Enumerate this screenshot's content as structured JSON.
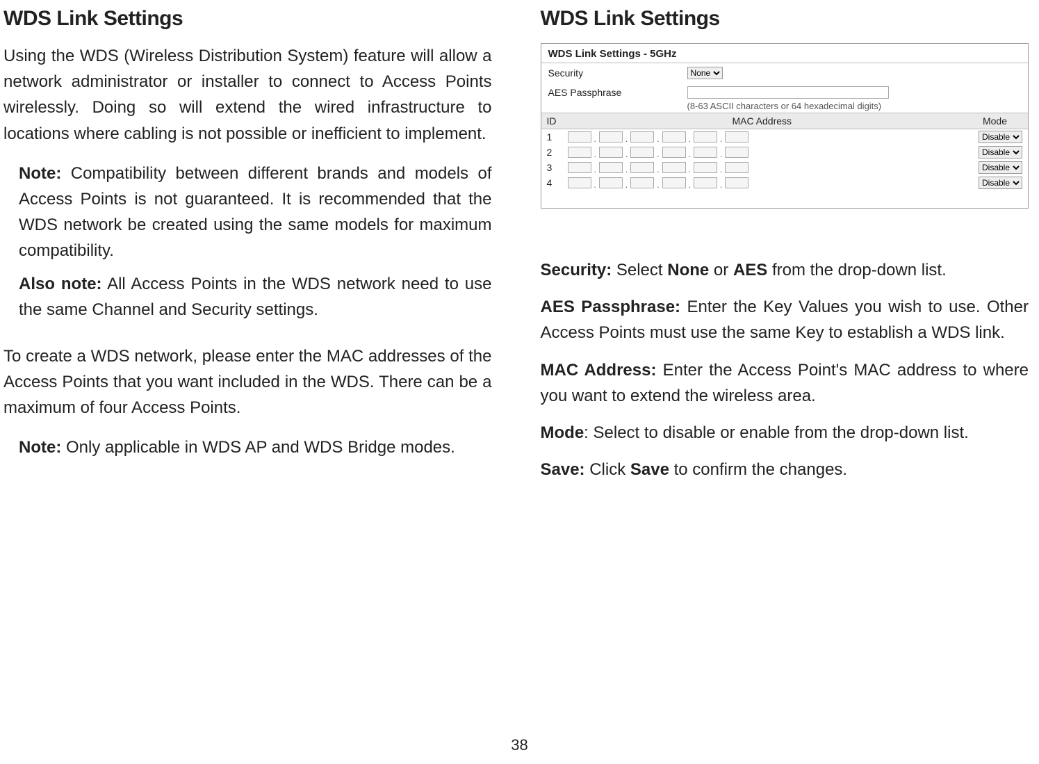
{
  "left": {
    "heading": "WDS Link Settings",
    "intro": "Using the WDS (Wireless Distribution System) feature will allow a network administrator or installer to connect to Access Points wirelessly. Doing so will extend the wired infrastructure to locations where cabling is not possible or inefficient to implement.",
    "note1_label": "Note:",
    "note1_text": " Compatibility between different brands and models of Access Points is not guaranteed. It is recommended that the WDS network be created using the same models for maximum compatibility.",
    "note2_label": "Also note:",
    "note2_text": " All Access Points in the WDS network need to use the same Channel and Security settings.",
    "para2": "To create a WDS network, please enter the MAC addresses of the Access Points that you want included in the WDS. There can be a maximum of four Access Points.",
    "note3_label": "Note:",
    "note3_text": " Only applicable in WDS AP and WDS Bridge modes."
  },
  "right": {
    "heading": "WDS Link Settings",
    "panel": {
      "title": "WDS Link Settings - 5GHz",
      "security_label": "Security",
      "security_value": "None",
      "passphrase_label": "AES Passphrase",
      "passphrase_hint": "(8-63 ASCII characters or 64 hexadecimal digits)",
      "table": {
        "headers": {
          "id": "ID",
          "mac": "MAC Address",
          "mode": "Mode"
        },
        "rows": [
          {
            "id": "1",
            "mode": "Disable"
          },
          {
            "id": "2",
            "mode": "Disable"
          },
          {
            "id": "3",
            "mode": "Disable"
          },
          {
            "id": "4",
            "mode": "Disable"
          }
        ]
      }
    },
    "defs": {
      "security_label": "Security:",
      "security_text": " Select ",
      "security_none": "None",
      "security_or": " or ",
      "security_aes": "AES",
      "security_rest": " from the drop-down list.",
      "aes_label": "AES Passphrase:",
      "aes_text": " Enter the Key Values you wish to use. Other Access Points must use the same Key to establish a WDS link.",
      "mac_label": "MAC Address:",
      "mac_text": " Enter the Access Point's MAC address to where you want to extend the wireless area.",
      "mode_label": "Mode",
      "mode_text": ": Select to disable or enable from the drop-down list.",
      "save_label": "Save:",
      "save_text1": " Click ",
      "save_bold": "Save",
      "save_text2": " to confirm the changes."
    }
  },
  "page_number": "38"
}
